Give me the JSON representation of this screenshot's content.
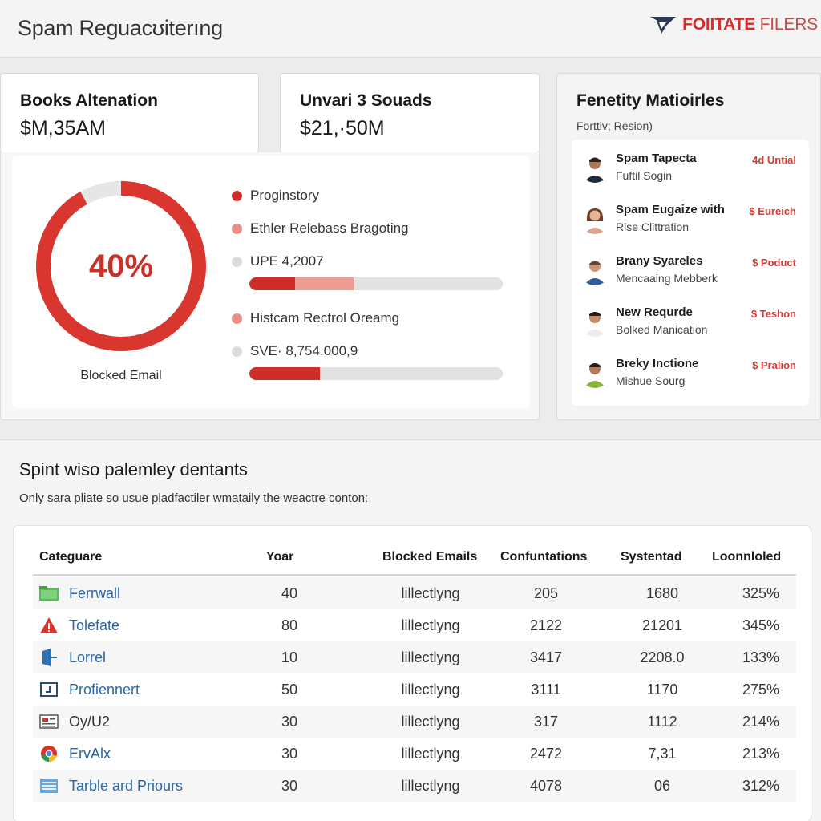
{
  "header": {
    "title": "Spam Reguacʊiterıng",
    "brand_name": "FOIITATE",
    "brand_suffix": "FILERS",
    "brand_color": "#d62c2c"
  },
  "stat_cards": [
    {
      "title": "Books Altenation",
      "value": "$M,35AM"
    },
    {
      "title": "Unvari 3 Souads",
      "value": "$21,·50M"
    }
  ],
  "donut": {
    "percent_label": "40%",
    "caption": "Blocked Email",
    "fill_fraction": 0.92,
    "color": "#d8362e",
    "track_color": "#e6e6e6"
  },
  "legend": [
    {
      "label": "Proginstory",
      "color": "#cc2f28"
    },
    {
      "label": "Ethler Relebass Bragoting",
      "color": "#ec8e86"
    },
    {
      "label": "UPE 4,2007",
      "color": "#dcdcdc"
    },
    {
      "label": "Histcam Rectrol Oreamg",
      "color": "#ec8e86"
    },
    {
      "label": "SVE· 8,754.000,9",
      "color": "#dcdcdc"
    }
  ],
  "progress_bars": [
    {
      "segments": [
        {
          "fraction": 0.18,
          "color": "#cc2f28"
        },
        {
          "fraction": 0.23,
          "color": "#ef9a92"
        }
      ]
    },
    {
      "segments": [
        {
          "fraction": 0.28,
          "color": "#cc2f28"
        }
      ]
    }
  ],
  "people_panel": {
    "title": "Fenetity Matioirles",
    "subtitle": "Forttiv; Resion)",
    "items": [
      {
        "name": "Spam Tapecta",
        "desc": "Fuftil Sogin",
        "badge": "4d Untial"
      },
      {
        "name": "Spam Eugaize with",
        "desc": "Rise Clittration",
        "badge": "$ Eureich"
      },
      {
        "name": "Brany Syareles",
        "desc": "Mencaaing Mebberk",
        "badge": "$ Poduct"
      },
      {
        "name": "New Requrde",
        "desc": "Bolked Manication",
        "badge": "$ Teshon"
      },
      {
        "name": "Breky Inctione",
        "desc": "Mishue Sourg",
        "badge": "$ Pralion"
      }
    ]
  },
  "section": {
    "title": "Spint wiso palemley dentants",
    "subtitle": "Only sara pliate so usue pladfactiler wmataily the weactre conton:"
  },
  "table": {
    "columns": [
      "Categuare",
      "Yoar",
      "Blocked Emails",
      "Confuntations",
      "Systentad",
      "Loonnloled"
    ],
    "rows": [
      {
        "icon": "green-folder-icon",
        "category": "Ferrwall",
        "year": "40",
        "blocked": "lillectlyng",
        "conf": "205",
        "sys": "1680",
        "pct": "325%"
      },
      {
        "icon": "red-warning-icon",
        "category": "Tolefate",
        "year": "80",
        "blocked": "lillectlyng",
        "conf": "2122",
        "sys": "21201",
        "pct": "345%"
      },
      {
        "icon": "blue-door-icon",
        "category": "Lorrel",
        "year": "10",
        "blocked": "lillectlyng",
        "conf": "3417",
        "sys": "2208.0",
        "pct": "133%"
      },
      {
        "icon": "terminal-icon",
        "category": "Profiennert",
        "year": "50",
        "blocked": "lillectlyng",
        "conf": "3111",
        "sys": "1170",
        "pct": "275%"
      },
      {
        "icon": "printer-icon",
        "category": "Oy/U2",
        "year": "30",
        "blocked": "lillectlyng",
        "conf": "317",
        "sys": "1112",
        "pct": "214%"
      },
      {
        "icon": "chrome-icon",
        "category": "ErvAlx",
        "year": "30",
        "blocked": "lillectlyng",
        "conf": "2472",
        "sys": "7,31",
        "pct": "213%"
      },
      {
        "icon": "table-icon",
        "category": "Tarble ard Priours",
        "year": "30",
        "blocked": "lillectlyng",
        "conf": "4078",
        "sys": "06",
        "pct": "312%"
      }
    ]
  }
}
